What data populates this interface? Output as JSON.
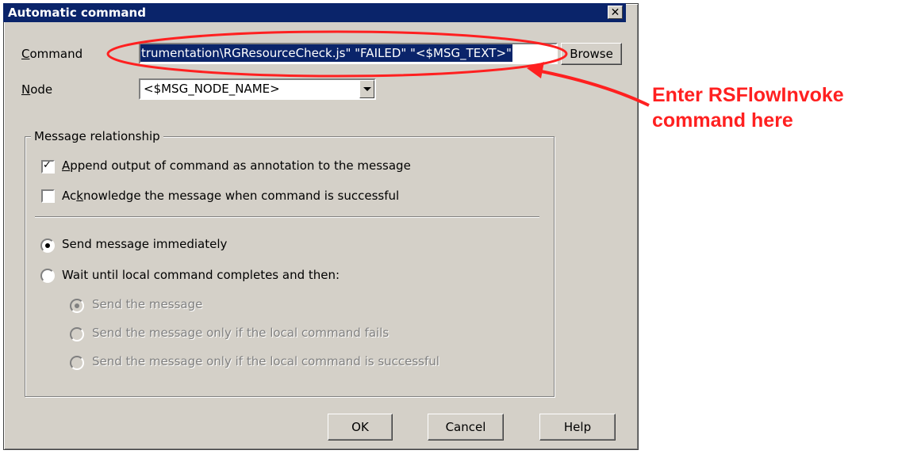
{
  "dialog": {
    "title": "Automatic command",
    "close_glyph": "✕"
  },
  "command": {
    "label_prefix": "",
    "label_underlined": "C",
    "label_rest": "ommand",
    "value": "trumentation\\RGResourceCheck.js\" \"FAILED\" \"<$MSG_TEXT>\"",
    "browse_label": "Browse"
  },
  "node": {
    "label_underlined": "N",
    "label_rest": "ode",
    "selected": "<$MSG_NODE_NAME>"
  },
  "message_relationship": {
    "group_title": "Message relationship",
    "append_option": {
      "underlined": "A",
      "rest": "ppend output of command as annotation to the message",
      "checked": true
    },
    "acknowledge_option": {
      "prefix": "Ac",
      "underlined": "k",
      "rest": "nowledge the message when command is successful",
      "checked": false
    },
    "send_immediately": {
      "label": "Send message immediately",
      "selected": true
    },
    "wait_until": {
      "label": "Wait until local command completes and then:",
      "selected": false
    },
    "sub_options": [
      {
        "label": "Send the message",
        "selected": true
      },
      {
        "label": "Send the message only if the local command fails",
        "selected": false
      },
      {
        "label": "Send the message only if the local command is successful",
        "selected": false
      }
    ]
  },
  "buttons": {
    "ok": "OK",
    "cancel": "Cancel",
    "help": "Help"
  },
  "annotation": {
    "line1": "Enter RSFlowInvoke",
    "line2": "command here",
    "color": "#ff2020"
  }
}
